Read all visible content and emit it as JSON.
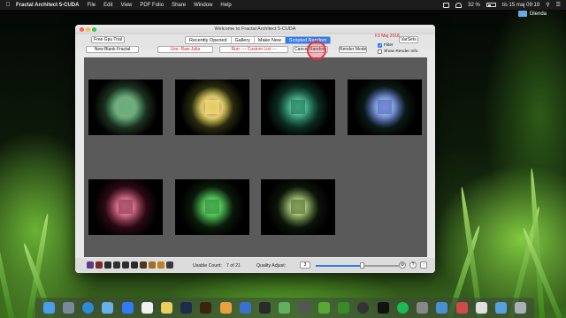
{
  "menubar": {
    "app_name": "Fractal Architect 5-CUDA",
    "items": [
      "File",
      "Edit",
      "View",
      "PDF Folio",
      "Share",
      "Window",
      "Help"
    ],
    "battery": "32 %",
    "clock": "tis 15 maj  09:19"
  },
  "desktop": {
    "item_label": "Glenda"
  },
  "window": {
    "title": "Welcome to Fractal Architect 5-CUDA",
    "free_trial_label": "Free Gpu Trial",
    "tabs": [
      "Recently Opened",
      "Gallery",
      "Make New",
      "Scripted Random"
    ],
    "active_tab": "Scripted Random",
    "date": "F3 Maj 2018",
    "varsets_label": "VarSets",
    "new_blank_label": "New Blank Fractal",
    "use_label": "Use: Raw Julia",
    "run_label": "Run: --- Custom List ---",
    "cancel_label": "Cancel Random",
    "render_mode_label": "Render Mode",
    "filter_label": "Filter",
    "filter_checked": true,
    "show_render_info_label": "Show Render Info",
    "show_render_info_checked": false
  },
  "thumbnails": [
    {
      "name": "thumb-1",
      "colors": [
        "#c08a8a",
        "#5fb47a",
        "#1c3020"
      ]
    },
    {
      "name": "thumb-2",
      "colors": [
        "#d066d0",
        "#e6e05a",
        "#2a2a10"
      ]
    },
    {
      "name": "thumb-3",
      "colors": [
        "#7ee0b8",
        "#2f8a6a",
        "#0b2a20"
      ]
    },
    {
      "name": "thumb-4",
      "colors": [
        "#9fe6a0",
        "#6a7ad8",
        "#0a1a14"
      ]
    },
    {
      "name": "thumb-5",
      "colors": [
        "#f2a8b0",
        "#a84a66",
        "#2a0a12"
      ]
    },
    {
      "name": "thumb-6",
      "colors": [
        "#7fe870",
        "#3fa048",
        "#0a1a0a"
      ]
    },
    {
      "name": "thumb-7",
      "colors": [
        "#e8f0a8",
        "#6c8a4a",
        "#0c140a"
      ]
    }
  ],
  "bottom": {
    "usable_count_label": "Usable Count:",
    "usable_count_value": "7 of 21",
    "quality_label": "Quality Adjust:",
    "quality_value": "3",
    "quality_slider_fraction": 0.55,
    "help_glyph": "?"
  },
  "colors": {
    "accent": "#2f7cf6",
    "alert": "#cf1f25",
    "close": "#fc605b",
    "minimize": "#fdbc40",
    "zoom": "#34c84a"
  }
}
